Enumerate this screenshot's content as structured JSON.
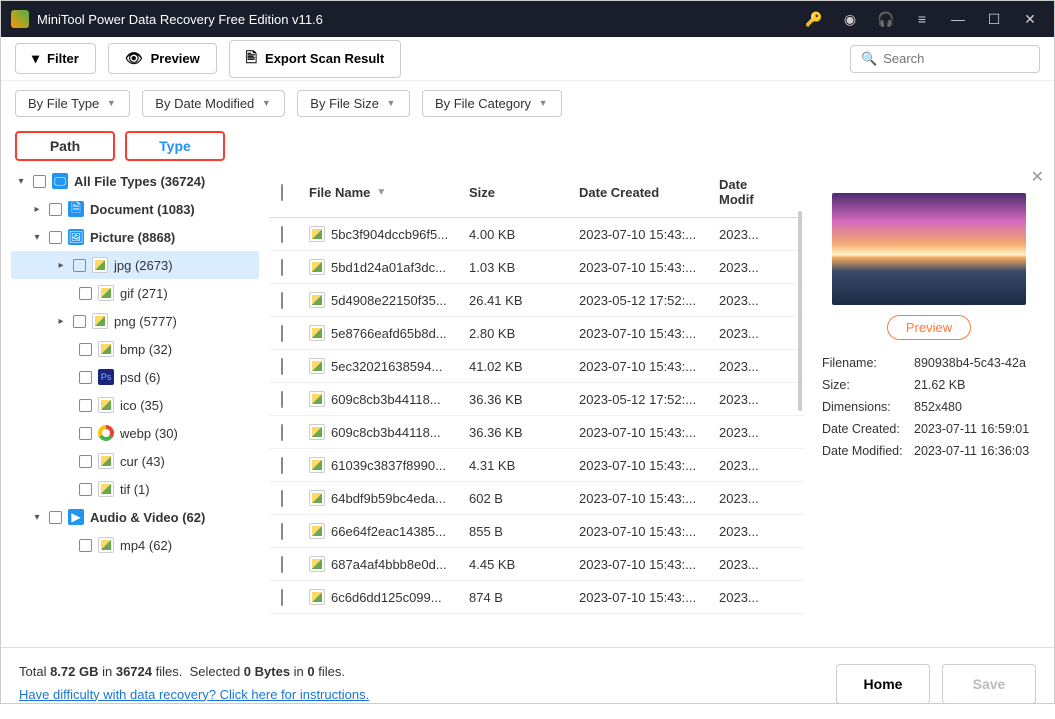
{
  "window": {
    "title": "MiniTool Power Data Recovery Free Edition v11.6"
  },
  "toolbar": {
    "filter": "Filter",
    "preview": "Preview",
    "export": "Export Scan Result",
    "search_placeholder": "Search"
  },
  "filters": {
    "by_type": "By File Type",
    "by_date": "By Date Modified",
    "by_size": "By File Size",
    "by_cat": "By File Category"
  },
  "tabs": {
    "path": "Path",
    "type": "Type"
  },
  "tree": {
    "root": "All File Types (36724)",
    "document": "Document (1083)",
    "picture": "Picture (8868)",
    "jpg": "jpg (2673)",
    "gif": "gif (271)",
    "png": "png (5777)",
    "bmp": "bmp (32)",
    "psd": "psd (6)",
    "ico": "ico (35)",
    "webp": "webp (30)",
    "cur": "cur (43)",
    "tif": "tif (1)",
    "av": "Audio & Video (62)",
    "mp4": "mp4 (62)"
  },
  "table": {
    "headers": {
      "name": "File Name",
      "size": "Size",
      "date": "Date Created",
      "mod": "Date Modif"
    },
    "rows": [
      {
        "name": "5bc3f904dccb96f5...",
        "size": "4.00 KB",
        "date": "2023-07-10 15:43:...",
        "mod": "2023..."
      },
      {
        "name": "5bd1d24a01af3dc...",
        "size": "1.03 KB",
        "date": "2023-07-10 15:43:...",
        "mod": "2023..."
      },
      {
        "name": "5d4908e22150f35...",
        "size": "26.41 KB",
        "date": "2023-05-12 17:52:...",
        "mod": "2023..."
      },
      {
        "name": "5e8766eafd65b8d...",
        "size": "2.80 KB",
        "date": "2023-07-10 15:43:...",
        "mod": "2023..."
      },
      {
        "name": "5ec32021638594...",
        "size": "41.02 KB",
        "date": "2023-07-10 15:43:...",
        "mod": "2023..."
      },
      {
        "name": "609c8cb3b44118...",
        "size": "36.36 KB",
        "date": "2023-05-12 17:52:...",
        "mod": "2023..."
      },
      {
        "name": "609c8cb3b44118...",
        "size": "36.36 KB",
        "date": "2023-07-10 15:43:...",
        "mod": "2023..."
      },
      {
        "name": "61039c3837f8990...",
        "size": "4.31 KB",
        "date": "2023-07-10 15:43:...",
        "mod": "2023..."
      },
      {
        "name": "64bdf9b59bc4eda...",
        "size": "602 B",
        "date": "2023-07-10 15:43:...",
        "mod": "2023..."
      },
      {
        "name": "66e64f2eac14385...",
        "size": "855 B",
        "date": "2023-07-10 15:43:...",
        "mod": "2023..."
      },
      {
        "name": "687a4af4bbb8e0d...",
        "size": "4.45 KB",
        "date": "2023-07-10 15:43:...",
        "mod": "2023..."
      },
      {
        "name": "6c6d6dd125c099...",
        "size": "874 B",
        "date": "2023-07-10 15:43:...",
        "mod": "2023..."
      }
    ]
  },
  "detail": {
    "preview_btn": "Preview",
    "fields": {
      "filename_k": "Filename:",
      "filename_v": "890938b4-5c43-42a",
      "size_k": "Size:",
      "size_v": "21.62 KB",
      "dim_k": "Dimensions:",
      "dim_v": "852x480",
      "created_k": "Date Created:",
      "created_v": "2023-07-11 16:59:01",
      "modified_k": "Date Modified:",
      "modified_v": "2023-07-11 16:36:03"
    }
  },
  "bottom": {
    "total_prefix": "Total ",
    "total_size": "8.72 GB",
    "total_mid": " in ",
    "total_count": "36724",
    "total_suffix": " files. ",
    "selected_prefix": "Selected ",
    "selected_bytes": "0 Bytes",
    "selected_mid": " in ",
    "selected_count": "0",
    "selected_suffix": " files.",
    "help": "Have difficulty with data recovery? Click here for instructions.",
    "home": "Home",
    "save": "Save"
  }
}
